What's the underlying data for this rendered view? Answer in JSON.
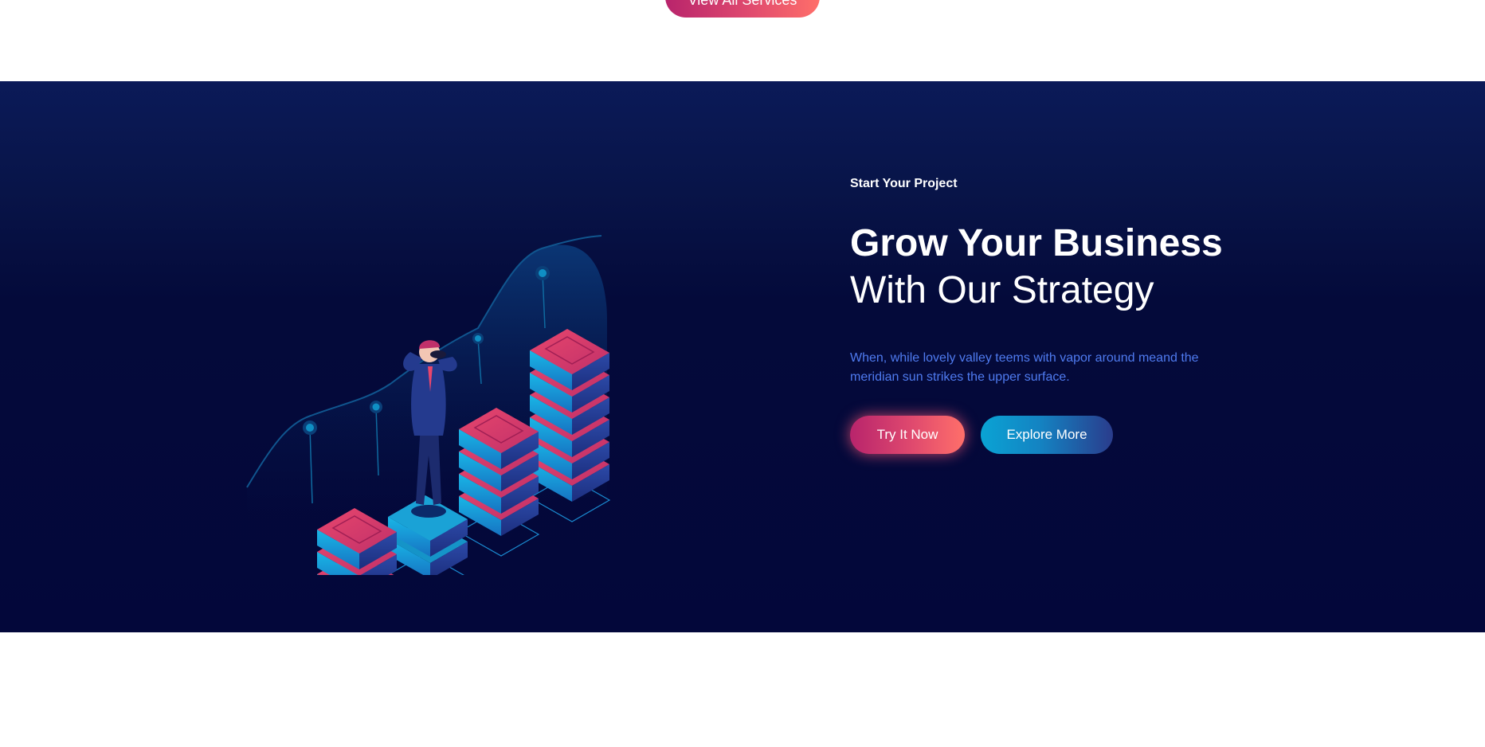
{
  "services": {
    "view_all_label": "View All Services"
  },
  "cta": {
    "eyebrow": "Start Your Project",
    "headline_bold": "Grow Your Business",
    "headline_regular": "With Our Strategy",
    "description": "When, while lovely valley teems with vapor around meand the meridian sun strikes the upper surface.",
    "primary_button": "Try It Now",
    "secondary_button": "Explore More"
  },
  "colors": {
    "section_bg": "#03073a",
    "accent_pink": "#e04a6e",
    "accent_blue": "#0aa3d4",
    "description_text": "#4f7bf0"
  },
  "illustration": {
    "icon": "business-growth-illustration"
  }
}
